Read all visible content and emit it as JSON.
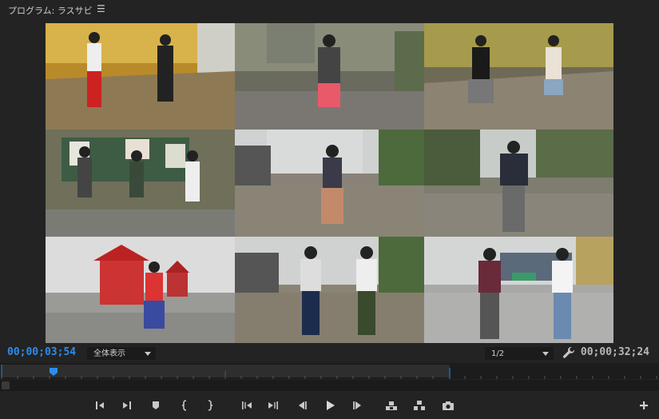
{
  "panel": {
    "title": "プログラム: ラスサビ",
    "menu_icon": "hamburger-menu-icon"
  },
  "timecode": {
    "current": "00;00;03;54",
    "duration": "00;00;32;24"
  },
  "zoom_select": {
    "value": "全体表示"
  },
  "resolution_select": {
    "value": "1/2"
  },
  "colors": {
    "accent": "#2d8ceb",
    "background": "#232323"
  },
  "controls": [
    {
      "name": "mark-in-icon"
    },
    {
      "name": "mark-out-icon"
    },
    {
      "name": "add-marker-icon"
    },
    {
      "name": "mark-in-brace-icon"
    },
    {
      "name": "mark-out-brace-icon"
    },
    {
      "name": "go-to-in-icon"
    },
    {
      "name": "go-to-out-icon"
    },
    {
      "name": "step-back-icon"
    },
    {
      "name": "play-icon"
    },
    {
      "name": "step-forward-icon"
    },
    {
      "name": "lift-icon"
    },
    {
      "name": "extract-icon"
    },
    {
      "name": "export-frame-icon"
    },
    {
      "name": "add-button-icon"
    }
  ],
  "video_frames": [
    {
      "name": "video-frame-1"
    },
    {
      "name": "video-frame-2"
    },
    {
      "name": "video-frame-3"
    },
    {
      "name": "video-frame-4"
    },
    {
      "name": "video-frame-5"
    },
    {
      "name": "video-frame-6"
    },
    {
      "name": "video-frame-7"
    },
    {
      "name": "video-frame-8"
    },
    {
      "name": "video-frame-9"
    }
  ]
}
